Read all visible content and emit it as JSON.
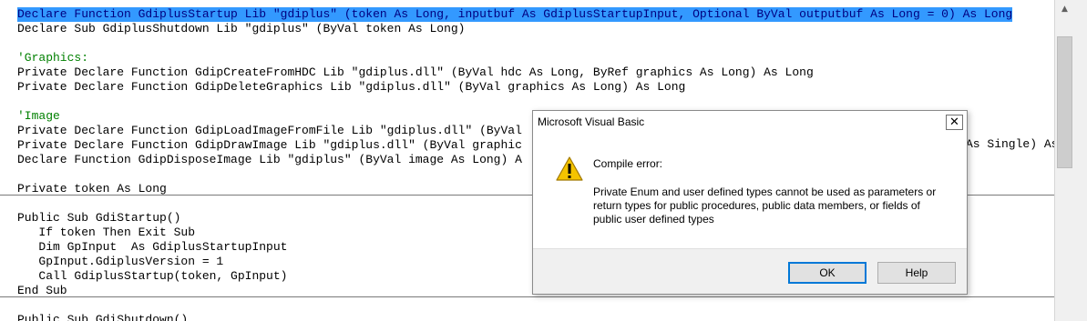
{
  "code_lines": [
    {
      "text": "Declare Function GdiplusStartup Lib \"gdiplus\" (token As Long, inputbuf As GdiplusStartupInput, Optional ByVal outputbuf As Long = 0) As Long",
      "kind": "selected"
    },
    {
      "text": "Declare Sub GdiplusShutdown Lib \"gdiplus\" (ByVal token As Long)",
      "kind": "code"
    },
    {
      "text": "",
      "kind": "code"
    },
    {
      "text": "'Graphics:",
      "kind": "comment"
    },
    {
      "text": "Private Declare Function GdipCreateFromHDC Lib \"gdiplus.dll\" (ByVal hdc As Long, ByRef graphics As Long) As Long",
      "kind": "code"
    },
    {
      "text": "Private Declare Function GdipDeleteGraphics Lib \"gdiplus.dll\" (ByVal graphics As Long) As Long",
      "kind": "code"
    },
    {
      "text": "",
      "kind": "code"
    },
    {
      "text": "'Image",
      "kind": "comment"
    },
    {
      "text": "Private Declare Function GdipLoadImageFromFile Lib \"gdiplus.dll\" (ByVal",
      "kind": "code"
    },
    {
      "text": "Private Declare Function GdipDrawImage Lib \"gdiplus.dll\" (ByVal graphic",
      "kind": "code"
    },
    {
      "text": "Declare Function GdipDisposeImage Lib \"gdiplus\" (ByVal image As Long) A",
      "kind": "code"
    },
    {
      "text": "",
      "kind": "code"
    },
    {
      "text": "Private token As Long",
      "kind": "code"
    },
    {
      "text": "",
      "kind": "code"
    },
    {
      "text": "Public Sub GdiStartup()",
      "kind": "code"
    },
    {
      "text": "   If token Then Exit Sub",
      "kind": "code"
    },
    {
      "text": "   Dim GpInput  As GdiplusStartupInput",
      "kind": "code"
    },
    {
      "text": "   GpInput.GdiplusVersion = 1",
      "kind": "code"
    },
    {
      "text": "   Call GdiplusStartup(token, GpInput)",
      "kind": "code"
    },
    {
      "text": "End Sub",
      "kind": "code"
    },
    {
      "text": "",
      "kind": "code"
    },
    {
      "text": "Public Sub GdiShutdown()",
      "kind": "code"
    }
  ],
  "right_fragment": "As Single) As",
  "dialog": {
    "title": "Microsoft Visual Basic",
    "close_glyph": "✕",
    "heading": "Compile error:",
    "message": "Private Enum and user defined types cannot be used as parameters or return types for public procedures, public data members, or fields of public user defined types",
    "ok_label": "OK",
    "help_label": "Help",
    "icon": "warning-icon"
  },
  "colors": {
    "selection": "#3399ff",
    "comment": "#008000",
    "warning_yellow": "#f5c400"
  }
}
